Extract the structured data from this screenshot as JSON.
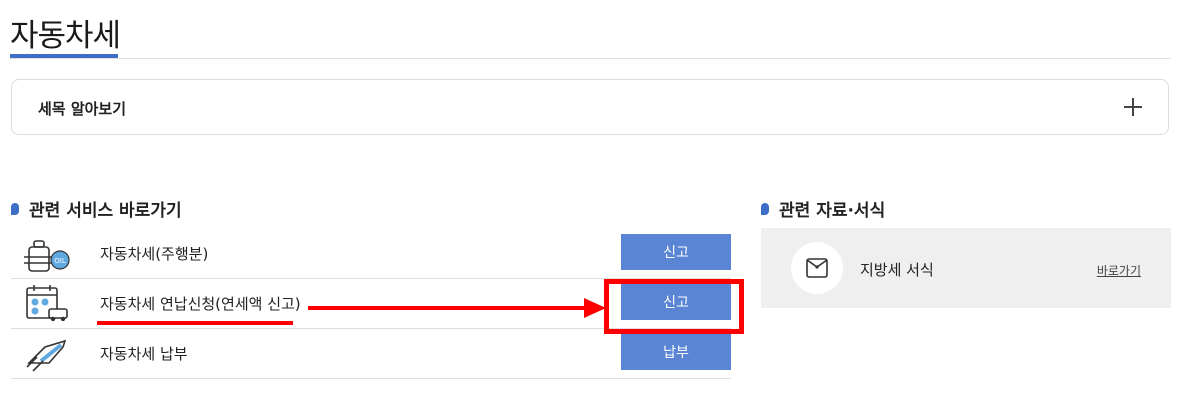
{
  "page": {
    "title": "자동차세"
  },
  "tax_info": {
    "label": "세목 알아보기",
    "expand_icon": "plus-icon"
  },
  "services": {
    "heading": "관련 서비스 바로가기",
    "items": [
      {
        "label": "자동차세(주행분)",
        "button": "신고",
        "icon": "fuel-tank-oil-icon"
      },
      {
        "label": "자동차세 연납신청(연세액 신고)",
        "button": "신고",
        "icon": "calendar-car-icon"
      },
      {
        "label": "자동차세 납부",
        "button": "납부",
        "icon": "card-payment-icon"
      }
    ]
  },
  "documents": {
    "heading": "관련 자료·서식",
    "item": {
      "label": "지방세 서식",
      "link": "바로가기",
      "icon": "envelope-icon"
    }
  },
  "colors": {
    "accent": "#3d6fc9",
    "button": "#5a85d4",
    "annotation": "#ff0000",
    "panel": "#efefef"
  }
}
